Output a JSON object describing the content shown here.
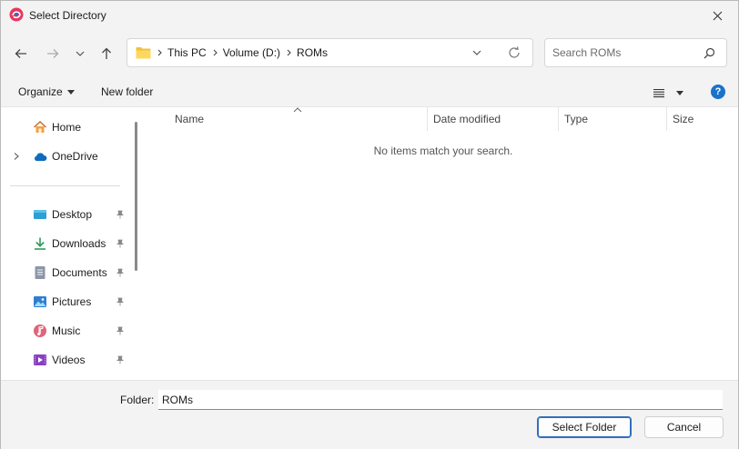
{
  "window": {
    "title": "Select Directory",
    "accent_color": "#1a73c9"
  },
  "address": {
    "breadcrumbs": [
      "This PC",
      "Volume (D:)",
      "ROMs"
    ]
  },
  "search": {
    "placeholder": "Search ROMs"
  },
  "toolbar": {
    "organize_label": "Organize",
    "new_folder_label": "New folder",
    "help_label": "?"
  },
  "sidebar": {
    "top_items": [
      {
        "label": "Home",
        "icon": "home-icon"
      },
      {
        "label": "OneDrive",
        "icon": "cloud-icon"
      }
    ],
    "quick_access": [
      {
        "label": "Desktop",
        "icon": "desktop-icon",
        "pinned": true
      },
      {
        "label": "Downloads",
        "icon": "download-icon",
        "pinned": true
      },
      {
        "label": "Documents",
        "icon": "documents-icon",
        "pinned": true
      },
      {
        "label": "Pictures",
        "icon": "pictures-icon",
        "pinned": true
      },
      {
        "label": "Music",
        "icon": "music-icon",
        "pinned": true
      },
      {
        "label": "Videos",
        "icon": "videos-icon",
        "pinned": true
      }
    ]
  },
  "content": {
    "columns": [
      "Name",
      "Date modified",
      "Type",
      "Size"
    ],
    "empty_message": "No items match your search."
  },
  "footer": {
    "folder_label": "Folder:",
    "folder_value": "ROMs",
    "select_label": "Select Folder",
    "cancel_label": "Cancel"
  }
}
